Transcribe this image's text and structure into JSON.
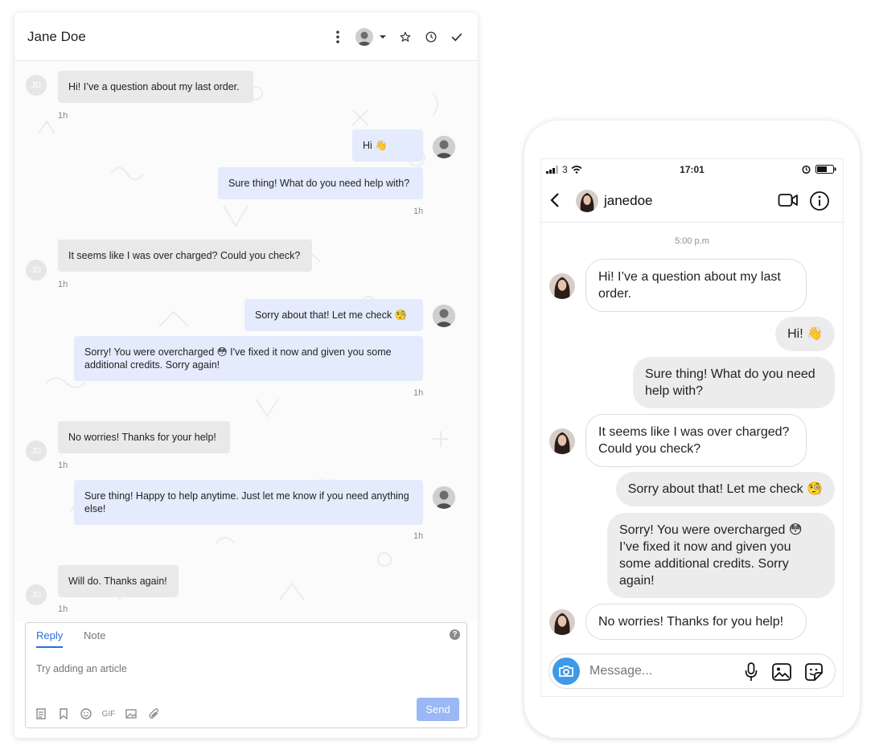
{
  "inbox": {
    "title": "Jane Doe",
    "customer_initials": "JD",
    "messages": [
      {
        "from": "customer",
        "text": "Hi! I’ve a question about my last order.",
        "time": "1h"
      },
      {
        "from": "agent",
        "text": "Hi 👋",
        "time": ""
      },
      {
        "from": "agent",
        "text": "Sure thing! What do you need help with?",
        "time": "1h"
      },
      {
        "from": "customer",
        "text": "It seems like I was over charged? Could you check?",
        "time": "1h"
      },
      {
        "from": "agent",
        "text": "Sorry about that! Let me check 🧐",
        "time": ""
      },
      {
        "from": "agent",
        "text": "Sorry! You were overcharged 😳 I've fixed it now and given you some additional credits. Sorry again!",
        "time": "1h"
      },
      {
        "from": "customer",
        "text": "No worries! Thanks for your help!",
        "time": "1h"
      },
      {
        "from": "agent",
        "text": "Sure thing! Happy to help anytime. Just let me know if you need anything else!",
        "time": "1h"
      },
      {
        "from": "customer",
        "text": "Will do. Thanks again!",
        "time": "1h"
      }
    ],
    "composer": {
      "tabs": [
        "Reply",
        "Note"
      ],
      "placeholder": "Try adding an article",
      "help": "?",
      "gif_label": "GIF",
      "send_label": "Send"
    },
    "header_icons": [
      "more-vertical-icon",
      "assignee-avatar",
      "chevron-down-icon",
      "star-icon",
      "clock-icon",
      "check-icon"
    ],
    "accent_color": "#2b6fdc"
  },
  "phone": {
    "status": {
      "signal": "3",
      "time": "17:01"
    },
    "username": "janedoe",
    "time_label": "5:00 p.m",
    "messages": [
      {
        "from": "them",
        "text": "Hi! I’ve a question about my last order."
      },
      {
        "from": "me",
        "text": "Hi! 👋"
      },
      {
        "from": "me",
        "text": "Sure thing! What do you need help with?"
      },
      {
        "from": "them",
        "text": "It seems like I was over charged? Could you check?"
      },
      {
        "from": "me",
        "text": "Sorry about that! Let me check 🧐"
      },
      {
        "from": "me",
        "text": "Sorry! You were overcharged 😳 I’ve fixed it now and given you some additional credits. Sorry again!"
      },
      {
        "from": "them",
        "text": "No worries! Thanks for you help!"
      }
    ],
    "input_placeholder": "Message...",
    "camera_color": "#3e9ae6"
  }
}
